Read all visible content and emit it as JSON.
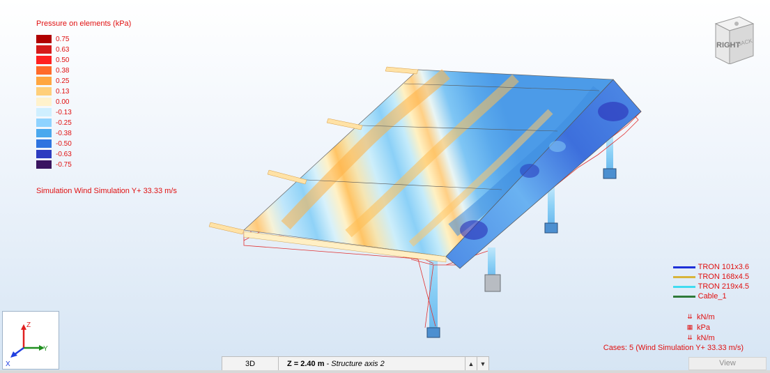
{
  "legend": {
    "title": "Pressure on elements (kPa)",
    "entries": [
      {
        "value": "0.75",
        "color": "#b00000"
      },
      {
        "value": "0.63",
        "color": "#d51a1a"
      },
      {
        "value": "0.50",
        "color": "#ff2020"
      },
      {
        "value": "0.38",
        "color": "#ff6a2a"
      },
      {
        "value": "0.25",
        "color": "#ffa640"
      },
      {
        "value": "0.13",
        "color": "#ffcf7a"
      },
      {
        "value": "0.00",
        "color": "#fff2cc"
      },
      {
        "value": "-0.13",
        "color": "#cfefff"
      },
      {
        "value": "-0.25",
        "color": "#8fd3ff"
      },
      {
        "value": "-0.38",
        "color": "#4aa8ee"
      },
      {
        "value": "-0.50",
        "color": "#2e74e0"
      },
      {
        "value": "-0.63",
        "color": "#2d3cc0"
      },
      {
        "value": "-0.75",
        "color": "#3a1560"
      }
    ]
  },
  "simulation_label": "Simulation Wind Simulation Y+ 33.33 m/s",
  "view_cube": {
    "face_main": "RIGHT",
    "face_side": "BACK"
  },
  "sections": [
    {
      "label": "TRON 101x3.6",
      "color": "#1d2fd8"
    },
    {
      "label": "TRON 168x4.5",
      "color": "#d8b43a"
    },
    {
      "label": "TRON 219x4.5",
      "color": "#40dcf0"
    },
    {
      "label": "Cable_1",
      "color": "#2f7a3a"
    }
  ],
  "units": [
    {
      "icon": "distributed-load-icon",
      "label": "kN/m"
    },
    {
      "icon": "surface-load-icon",
      "label": "kPa"
    },
    {
      "icon": "distributed-load-icon",
      "label": "kN/m"
    }
  ],
  "cases_label": "Cases: 5 (Wind Simulation Y+ 33.33 m/s)",
  "axes": {
    "z": "Z",
    "y": "Y",
    "x": "X"
  },
  "bottom_bar": {
    "view_mode": "3D",
    "z_value": "Z = 2.40 m",
    "z_sep": " - ",
    "axis_name": "Structure axis 2"
  },
  "view_button": "View",
  "accent_color": "#e01010"
}
